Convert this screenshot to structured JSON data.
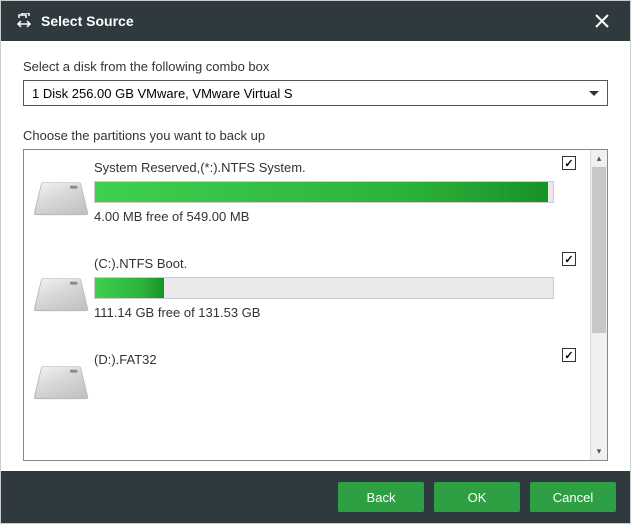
{
  "title": "Select Source",
  "disk_label": "Select a disk from the following combo box",
  "disk_selected": "1 Disk 256.00 GB VMware,  VMware Virtual S",
  "partition_label": "Choose the partitions you want to back up",
  "partitions": [
    {
      "title": "System Reserved,(*:).NTFS System.",
      "free": "4.00 MB free of 549.00 MB",
      "fill_percent": 99,
      "checked": true
    },
    {
      "title": "(C:).NTFS Boot.",
      "free": "111.14 GB free of 131.53 GB",
      "fill_percent": 15,
      "checked": true
    },
    {
      "title": "(D:).FAT32",
      "free": "",
      "fill_percent": 0,
      "checked": true
    }
  ],
  "buttons": {
    "back": "Back",
    "ok": "OK",
    "cancel": "Cancel"
  },
  "checkmark": "✓"
}
